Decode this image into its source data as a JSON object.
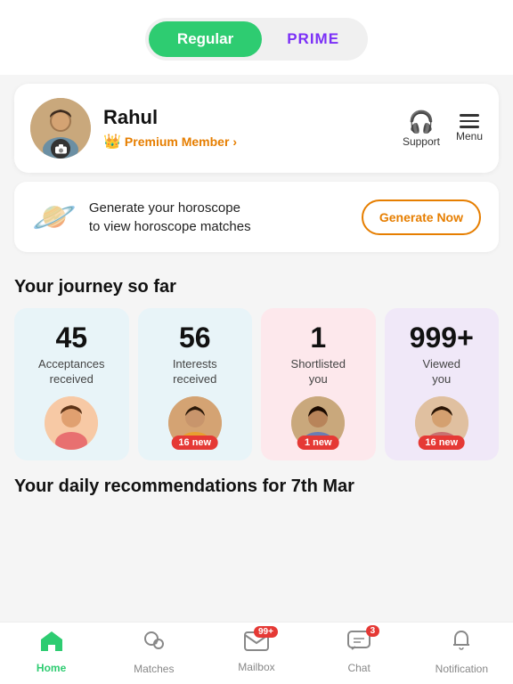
{
  "plan": {
    "regular_label": "Regular",
    "prime_label": "PRIME"
  },
  "profile": {
    "name": "Rahul",
    "badge": "Premium Member",
    "support_label": "Support",
    "menu_label": "Menu"
  },
  "horoscope": {
    "text_line1": "Generate your horoscope",
    "text_line2": "to view horoscope matches",
    "button_label": "Generate Now"
  },
  "journey": {
    "title": "Your journey so far",
    "stats": [
      {
        "number": "45",
        "label": "Acceptances\nreceived",
        "new_badge": null,
        "color": "blue"
      },
      {
        "number": "56",
        "label": "Interests\nreceived",
        "new_badge": "16 new",
        "color": "blue"
      },
      {
        "number": "1",
        "label": "Shortlisted\nyou",
        "new_badge": "1 new",
        "color": "pink"
      },
      {
        "number": "999+",
        "label": "Viewed\nyou",
        "new_badge": "16 new",
        "color": "lavender"
      }
    ]
  },
  "recommendations": {
    "title": "Your daily recommendations for 7th Mar"
  },
  "bottom_nav": {
    "items": [
      {
        "label": "Home",
        "icon": "home",
        "active": true,
        "badge": null
      },
      {
        "label": "Matches",
        "icon": "matches",
        "active": false,
        "badge": null
      },
      {
        "label": "Mailbox",
        "icon": "mailbox",
        "active": false,
        "badge": "99+"
      },
      {
        "label": "Chat",
        "icon": "chat",
        "active": false,
        "badge": "3"
      },
      {
        "label": "Notification",
        "icon": "notification",
        "active": false,
        "badge": null
      }
    ]
  }
}
